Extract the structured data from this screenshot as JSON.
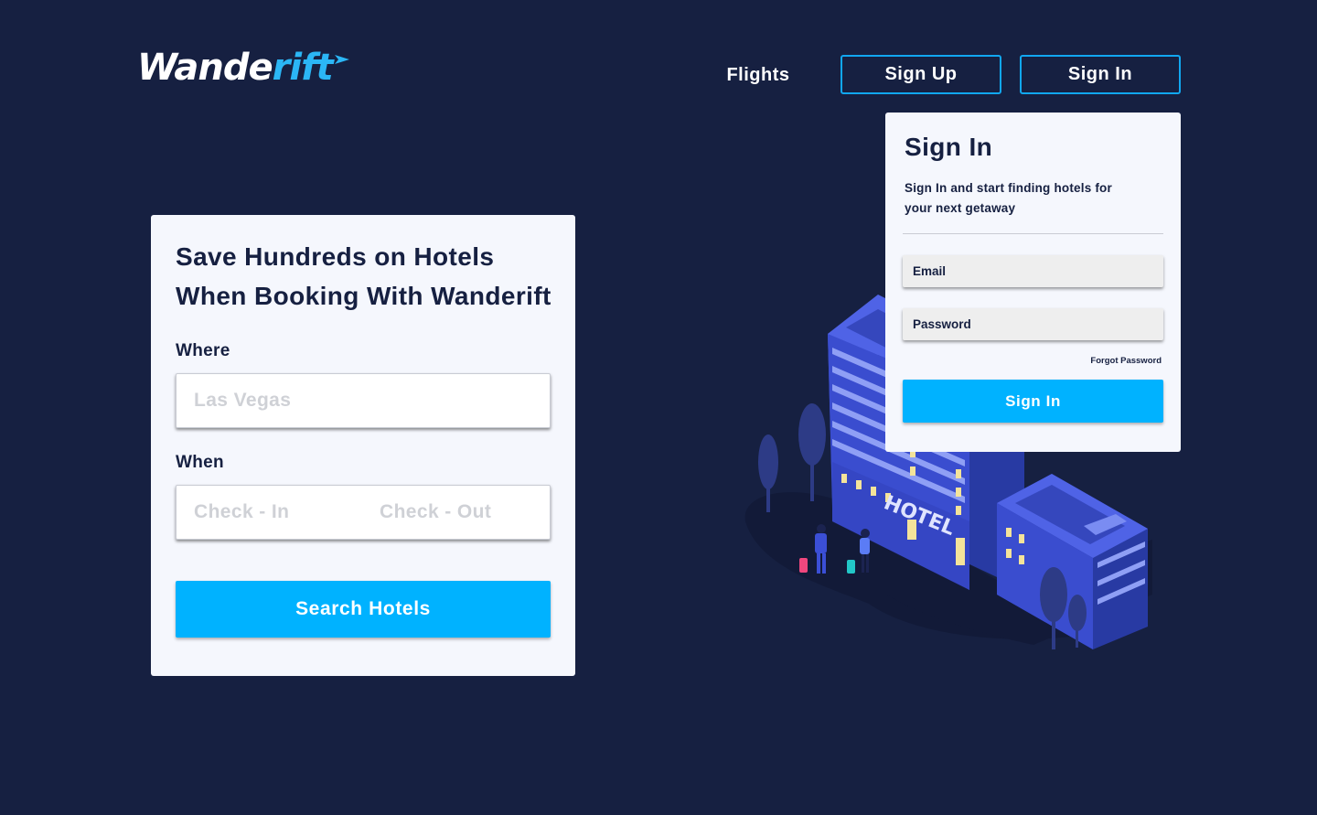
{
  "brand": {
    "name_main": "Wande",
    "name_accent": "rift"
  },
  "nav": {
    "flights": "Flights",
    "sign_up": "Sign Up",
    "sign_in": "Sign In"
  },
  "search": {
    "title_line1": "Save Hundreds on Hotels",
    "title_line2": "When Booking With Wanderift",
    "where_label": "Where",
    "where_placeholder": "Las Vegas",
    "when_label": "When",
    "checkin_placeholder": "Check - In",
    "checkout_placeholder": "Check - Out",
    "button": "Search Hotels"
  },
  "signin": {
    "title": "Sign In",
    "subtitle": "Sign In and start finding hotels for your next getaway",
    "email_placeholder": "Email",
    "password_placeholder": "Password",
    "forgot": "Forgot Password",
    "button": "Sign In"
  },
  "illustration": {
    "sign_text": "HOTEL"
  },
  "colors": {
    "background": "#162041",
    "accent": "#00b2ff",
    "card": "#f5f7fd",
    "text_dark": "#162041"
  }
}
